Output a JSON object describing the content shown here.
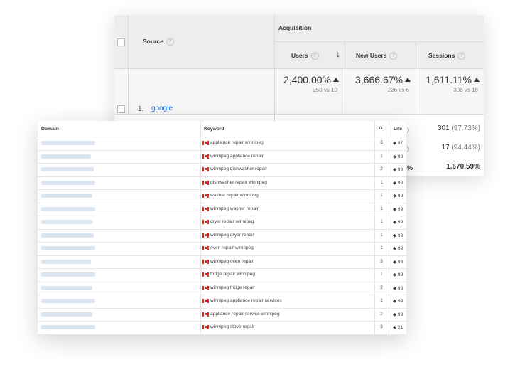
{
  "analytics": {
    "header": {
      "source_label": "Source",
      "group_label": "Acquisition",
      "users_label": "Users",
      "new_users_label": "New Users",
      "sessions_label": "Sessions",
      "help_glyph": "?"
    },
    "totals": {
      "users_value": "2,400.00%",
      "users_sub": "250 vs 10",
      "new_users_value": "3,666.67%",
      "new_users_sub": "226 vs 6",
      "sessions_value": "1,611.11%",
      "sessions_sub": "308 vs 18"
    },
    "rows": [
      {
        "num": "1.",
        "source": "google"
      }
    ],
    "right_values": [
      {
        "value": "301",
        "pct": "(97.73%)",
        "partial": ")"
      },
      {
        "value": "17",
        "pct": "(94.44%)",
        "partial": ")"
      },
      {
        "value": "1,670.59%",
        "pct": "",
        "partial": "%"
      }
    ]
  },
  "keywords": {
    "header": {
      "domain": "Domain",
      "keyword": "Keyword",
      "google_glyph": "G",
      "life": "Life"
    },
    "rows": [
      {
        "keyword": "appliance repair winnipeg",
        "rank": "3",
        "life": "◆ 97"
      },
      {
        "keyword": "winnipeg appliance repair",
        "rank": "1",
        "life": "◆ 99"
      },
      {
        "keyword": "winnipeg dishwasher repair",
        "rank": "2",
        "life": "◆ 98"
      },
      {
        "keyword": "dishwasher repair winnipeg",
        "rank": "1",
        "life": "◆ 99"
      },
      {
        "keyword": "washer repair winnipeg",
        "rank": "1",
        "life": "◆ 99"
      },
      {
        "keyword": "winnipeg washer repair",
        "rank": "1",
        "life": "◆ 99"
      },
      {
        "keyword": "dryer repair winnipeg",
        "rank": "1",
        "life": "◆ 99"
      },
      {
        "keyword": "winnipeg dryer repair",
        "rank": "1",
        "life": "◆ 99"
      },
      {
        "keyword": "oven repair winnipeg",
        "rank": "1",
        "life": "◆ 99"
      },
      {
        "keyword": "winnipeg oven repair",
        "rank": "3",
        "life": "◆ 98"
      },
      {
        "keyword": "fridge repair winnipeg",
        "rank": "1",
        "life": "◆ 99"
      },
      {
        "keyword": "winnipeg fridge repair",
        "rank": "2",
        "life": "◆ 98"
      },
      {
        "keyword": "winnipeg appliance repair services",
        "rank": "1",
        "life": "◆ 99"
      },
      {
        "keyword": "appliance repair service winnipeg",
        "rank": "2",
        "life": "◆ 98"
      },
      {
        "keyword": "winnipeg stove repair",
        "rank": "3",
        "life": "◆ 21"
      }
    ]
  },
  "colors": {
    "link": "#1a73e8",
    "flag_red": "#d52b1e",
    "google_blue": "#4285f4"
  }
}
